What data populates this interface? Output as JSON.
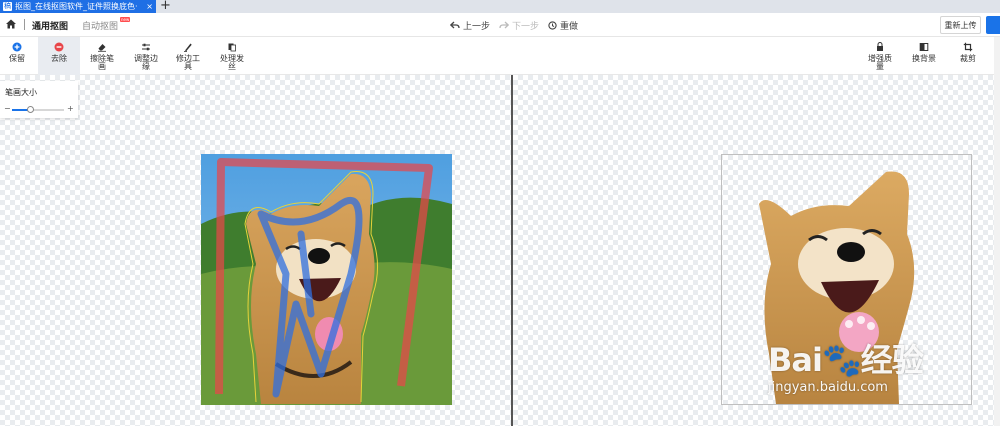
{
  "browser": {
    "tab_title": "抠图_在线抠图软件_证件照换底色·",
    "favicon_text": "稿",
    "close_glyph": "×",
    "new_tab_glyph": "+"
  },
  "header": {
    "mode_general": "通用抠图",
    "mode_auto": "自动抠图",
    "new_badge": "new",
    "undo": "上一步",
    "redo": "下一步",
    "reset": "重做",
    "reupload": "重新上传"
  },
  "toolbar": {
    "keep": "保留",
    "remove": "去除",
    "erase_strokes": "擦除笔画",
    "adjust_edge": "调整边缘",
    "edge_tool": "修边工具",
    "hair": "处理发丝",
    "enhance": "增强质量",
    "change_bg": "换背景",
    "crop": "裁剪"
  },
  "brush": {
    "title": "笔画大小",
    "minus": "−",
    "plus": "+",
    "level": 0.35
  },
  "watermark": {
    "brand": "Bai🐾经验",
    "url": "jingyan.baidu.com"
  },
  "colors": {
    "accent": "#1a73e8",
    "remove_red": "#e8464a",
    "keep_blue": "#2f6fe0"
  }
}
